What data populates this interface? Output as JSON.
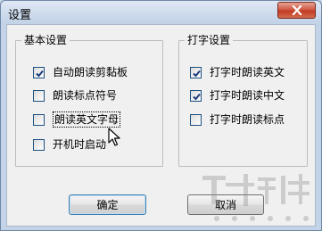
{
  "window": {
    "title": "设置"
  },
  "groups": {
    "basic": {
      "title": "基本设置",
      "items": [
        {
          "label": "自动朗读剪黏板",
          "checked": true
        },
        {
          "label": "朗读标点符号",
          "checked": false
        },
        {
          "label": "朗读英文字母",
          "checked": false,
          "focused": true
        },
        {
          "label": "开机时启动",
          "checked": false
        }
      ]
    },
    "typing": {
      "title": "打字设置",
      "items": [
        {
          "label": "打字时朗读英文",
          "checked": true
        },
        {
          "label": "打字时朗读中文",
          "checked": true
        },
        {
          "label": "打字时朗读标点",
          "checked": false
        }
      ]
    }
  },
  "buttons": {
    "ok": "确定",
    "cancel": "取消"
  }
}
